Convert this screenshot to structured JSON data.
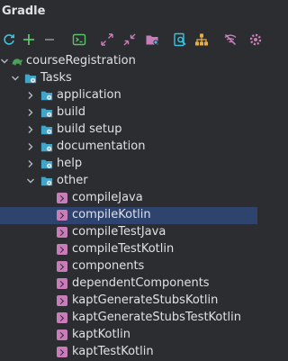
{
  "panel": {
    "title": "Gradle"
  },
  "toolbar": {
    "buttons": [
      {
        "name": "reload-icon",
        "color": "#3fc1e0"
      },
      {
        "name": "add-icon",
        "color": "#5bc46a"
      },
      {
        "name": "remove-icon",
        "color": "#8c8f94"
      },
      {
        "name": "execute-task-icon",
        "color": "#5bc46a"
      },
      {
        "name": "expand-all-icon",
        "color": "#c77db8"
      },
      {
        "name": "collapse-all-icon",
        "color": "#c77db8"
      },
      {
        "name": "link-folder-icon",
        "color": "#c77db8"
      },
      {
        "name": "analyze-dependencies-icon",
        "color": "#3fc1e0"
      },
      {
        "name": "show-dependencies-icon",
        "color": "#e8b041"
      },
      {
        "name": "toggle-offline-icon",
        "color": "#c77db8"
      },
      {
        "name": "settings-icon",
        "color": "#c77db8"
      }
    ]
  },
  "tree": {
    "root": {
      "label": "courseRegistration"
    },
    "tasks": {
      "label": "Tasks"
    },
    "groups": [
      {
        "label": "application"
      },
      {
        "label": "build"
      },
      {
        "label": "build setup"
      },
      {
        "label": "documentation"
      },
      {
        "label": "help"
      },
      {
        "label": "other"
      }
    ],
    "other_tasks": [
      {
        "label": "compileJava",
        "selected": false
      },
      {
        "label": "compileKotlin",
        "selected": true
      },
      {
        "label": "compileTestJava",
        "selected": false
      },
      {
        "label": "compileTestKotlin",
        "selected": false
      },
      {
        "label": "components",
        "selected": false
      },
      {
        "label": "dependentComponents",
        "selected": false
      },
      {
        "label": "kaptGenerateStubsKotlin",
        "selected": false
      },
      {
        "label": "kaptGenerateStubsTestKotlin",
        "selected": false
      },
      {
        "label": "kaptKotlin",
        "selected": false
      },
      {
        "label": "kaptTestKotlin",
        "selected": false
      }
    ]
  },
  "colors": {
    "background": "#2b2d30",
    "selection": "#2e436e",
    "folder": "#3fa6c9",
    "task": "#c77db8",
    "gradle": "#4ca158",
    "text": "#dfe1e5"
  }
}
